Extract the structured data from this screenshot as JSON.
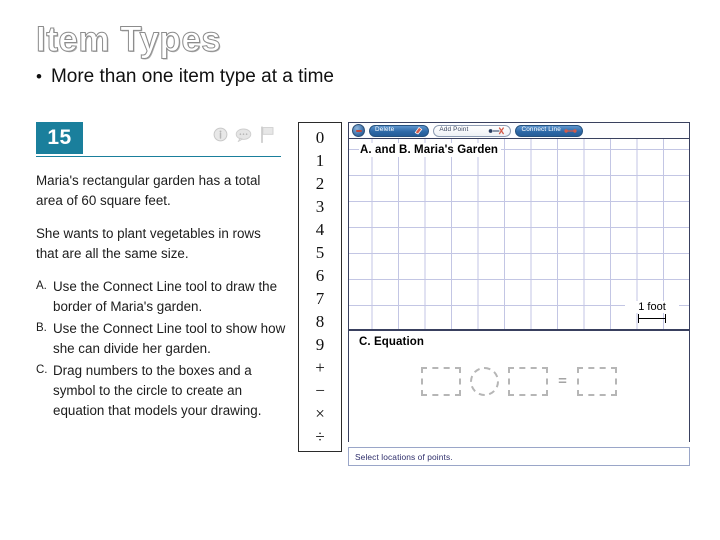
{
  "slide": {
    "title": "Item Types",
    "bullet_marker": "•",
    "bullet_text": "More than one item type at a time"
  },
  "question": {
    "number": "15",
    "header_icons": [
      {
        "name": "info-icon"
      },
      {
        "name": "comment-bubble-icon"
      },
      {
        "name": "flag-icon"
      }
    ],
    "paragraphs": [
      "Maria's rectangular garden has a total area of 60 square feet.",
      "She wants to plant vegetables in rows that are all the same size."
    ],
    "parts": [
      {
        "label": "A.",
        "text": "Use the Connect Line tool to draw the border of Maria's garden."
      },
      {
        "label": "B.",
        "text": "Use the Connect Line tool to show how she can divide her garden."
      },
      {
        "label": "C.",
        "text": "Drag numbers to the boxes and a symbol to the circle to create an equation that models your drawing."
      }
    ]
  },
  "palette": {
    "tiles": [
      "0",
      "1",
      "2",
      "3",
      "4",
      "5",
      "6",
      "7",
      "8",
      "9",
      "+",
      "−",
      "×",
      "÷"
    ]
  },
  "toolbar": {
    "delete_label": "Delete",
    "add_point_label": "Add Point",
    "connect_line_label": "Connect Line"
  },
  "canvas": {
    "title": "A. and B. Maria's Garden",
    "scale_label": "1 foot"
  },
  "equation": {
    "title": "C. Equation",
    "equals_sign": "=",
    "slots": [
      "box",
      "circle",
      "box",
      "equals",
      "box"
    ]
  },
  "status": {
    "message": "Select locations of points."
  },
  "colors": {
    "badge_teal": "#1a7f9c",
    "grid_line": "#c3c6e4",
    "panel_border": "#39405f",
    "toolbar_blue": "#2e69a8",
    "status_text": "#2e2e6b"
  }
}
